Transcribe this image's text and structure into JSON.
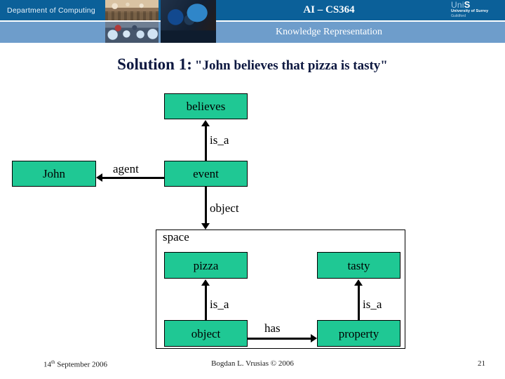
{
  "header": {
    "department": "Department of Computing",
    "course_code": "AI – CS364",
    "course_topic": "Knowledge Representation",
    "logo": {
      "mark_prefix": "Uni",
      "mark_suffix": "S",
      "university": "University of Surrey",
      "location": "Guildford"
    },
    "colors": {
      "band_dark": "#0b6099",
      "band_light": "#6e9dcb"
    }
  },
  "slide": {
    "title_lead": "Solution 1:",
    "title_rest": "\"John believes that pizza is tasty\"",
    "title_color": "#0d1840"
  },
  "diagram": {
    "node_fill": "#1fc894",
    "nodes": [
      {
        "id": "believes",
        "label": "believes"
      },
      {
        "id": "john",
        "label": "John"
      },
      {
        "id": "event",
        "label": "event"
      },
      {
        "id": "pizza",
        "label": "pizza"
      },
      {
        "id": "tasty",
        "label": "tasty"
      },
      {
        "id": "object",
        "label": "object"
      },
      {
        "id": "property",
        "label": "property"
      }
    ],
    "container": {
      "id": "space",
      "label": "space"
    },
    "edges": [
      {
        "id": "event-isa-believes",
        "label": "is_a",
        "from": "event",
        "to": "believes",
        "direction": "up"
      },
      {
        "id": "event-agent-john",
        "label": "agent",
        "from": "event",
        "to": "john",
        "direction": "left"
      },
      {
        "id": "event-object-space",
        "label": "object",
        "from": "event",
        "to": "space",
        "direction": "down"
      },
      {
        "id": "object-isa-pizza",
        "label": "is_a",
        "from": "object",
        "to": "pizza",
        "direction": "up"
      },
      {
        "id": "object-has-property",
        "label": "has",
        "from": "object",
        "to": "property",
        "direction": "right"
      },
      {
        "id": "property-isa-tasty",
        "label": "is_a",
        "from": "property",
        "to": "tasty",
        "direction": "up"
      }
    ]
  },
  "footer": {
    "date_day": "14",
    "date_ordinal": "th",
    "date_rest": " September 2006",
    "author": "Bogdan L. Vrusias © 2006",
    "page_number": "21"
  }
}
